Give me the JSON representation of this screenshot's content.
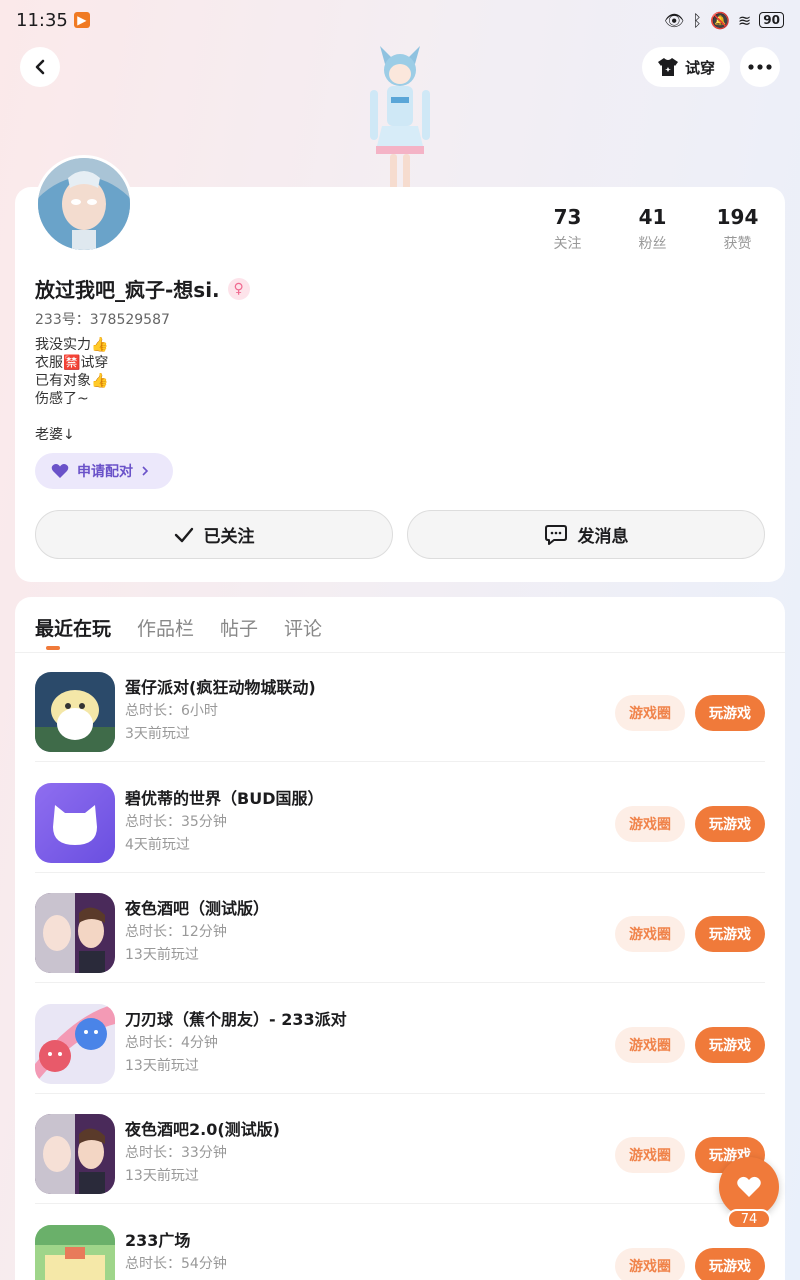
{
  "status_bar": {
    "time": "11:35",
    "battery": "90"
  },
  "header": {
    "try_on_label": "试穿"
  },
  "profile": {
    "stats": [
      {
        "num": "73",
        "label": "关注"
      },
      {
        "num": "41",
        "label": "粉丝"
      },
      {
        "num": "194",
        "label": "获赞"
      }
    ],
    "username": "放过我吧_疯子-想si.",
    "uid": "233号：378529587",
    "bio": [
      "我没实力👍",
      "衣服🈲试穿",
      "已有对象👍",
      "伤感了~"
    ],
    "extra_line": "老婆↓",
    "pair_label": "申请配对",
    "follow_label": "已关注",
    "message_label": "发消息"
  },
  "tabs": [
    "最近在玩",
    "作品栏",
    "帖子",
    "评论"
  ],
  "games": [
    {
      "title": "蛋仔派对(疯狂动物城联动)",
      "duration": "总时长：6小时",
      "last": "3天前玩过",
      "circle": "游戏圈",
      "play": "玩游戏"
    },
    {
      "title": "碧优蒂的世界（BUD国服）",
      "duration": "总时长：35分钟",
      "last": "4天前玩过",
      "circle": "游戏圈",
      "play": "玩游戏"
    },
    {
      "title": "夜色酒吧（测试版）",
      "duration": "总时长：12分钟",
      "last": "13天前玩过",
      "circle": "游戏圈",
      "play": "玩游戏"
    },
    {
      "title": "刀刃球（蕉个朋友）- 233派对",
      "duration": "总时长：4分钟",
      "last": "13天前玩过",
      "circle": "游戏圈",
      "play": "玩游戏"
    },
    {
      "title": "夜色酒吧2.0(测试版)",
      "duration": "总时长：33分钟",
      "last": "13天前玩过",
      "circle": "游戏圈",
      "play": "玩游戏"
    },
    {
      "title": "233广场",
      "duration": "总时长：54分钟",
      "last": "",
      "circle": "游戏圈",
      "play": "玩游戏"
    }
  ],
  "fab": {
    "count": "74"
  },
  "colors": {
    "accent": "#f07a3a",
    "accent_light": "#fdeee6",
    "pair_purple": "#6a52c9"
  }
}
